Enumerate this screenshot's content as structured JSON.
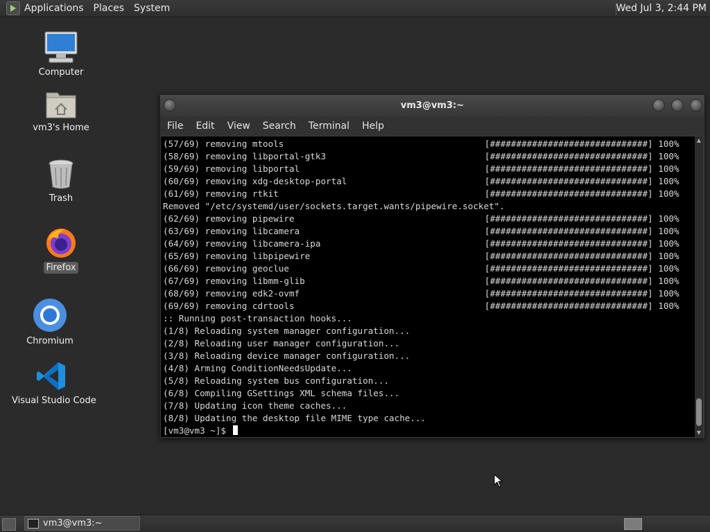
{
  "top_panel": {
    "menus": [
      "Applications",
      "Places",
      "System"
    ],
    "clock": "Wed Jul  3,  2:44 PM"
  },
  "desktop_icons": [
    {
      "label": "Computer",
      "icon": "computer-icon"
    },
    {
      "label": "vm3's Home",
      "icon": "home-folder-icon"
    },
    {
      "label": "Trash",
      "icon": "trash-icon"
    },
    {
      "label": "Firefox",
      "icon": "firefox-icon",
      "selected": true
    },
    {
      "label": "Chromium",
      "icon": "chromium-icon"
    },
    {
      "label": "Visual Studio Code",
      "icon": "vscode-icon"
    }
  ],
  "terminal": {
    "title": "vm3@vm3:~",
    "menu": [
      "File",
      "Edit",
      "View",
      "Search",
      "Terminal",
      "Help"
    ],
    "progress_bar": "[##############################]",
    "progress_pct": "100%",
    "lines": [
      {
        "text": "(57/69) removing mtools",
        "progress": true
      },
      {
        "text": "(58/69) removing libportal-gtk3",
        "progress": true
      },
      {
        "text": "(59/69) removing libportal",
        "progress": true
      },
      {
        "text": "(60/69) removing xdg-desktop-portal",
        "progress": true
      },
      {
        "text": "(61/69) removing rtkit",
        "progress": true
      },
      {
        "text": "Removed \"/etc/systemd/user/sockets.target.wants/pipewire.socket\".",
        "progress": false
      },
      {
        "text": "(62/69) removing pipewire",
        "progress": true
      },
      {
        "text": "(63/69) removing libcamera",
        "progress": true
      },
      {
        "text": "(64/69) removing libcamera-ipa",
        "progress": true
      },
      {
        "text": "(65/69) removing libpipewire",
        "progress": true
      },
      {
        "text": "(66/69) removing geoclue",
        "progress": true
      },
      {
        "text": "(67/69) removing libmm-glib",
        "progress": true
      },
      {
        "text": "(68/69) removing edk2-ovmf",
        "progress": true
      },
      {
        "text": "(69/69) removing cdrtools",
        "progress": true
      },
      {
        "text": ":: Running post-transaction hooks...",
        "progress": false
      },
      {
        "text": "(1/8) Reloading system manager configuration...",
        "progress": false
      },
      {
        "text": "(2/8) Reloading user manager configuration...",
        "progress": false
      },
      {
        "text": "(3/8) Reloading device manager configuration...",
        "progress": false
      },
      {
        "text": "(4/8) Arming ConditionNeedsUpdate...",
        "progress": false
      },
      {
        "text": "(5/8) Reloading system bus configuration...",
        "progress": false
      },
      {
        "text": "(6/8) Compiling GSettings XML schema files...",
        "progress": false
      },
      {
        "text": "(7/8) Updating icon theme caches...",
        "progress": false
      },
      {
        "text": "(8/8) Updating the desktop file MIME type cache...",
        "progress": false
      }
    ],
    "prompt": "[vm3@vm3 ~]$ "
  },
  "bottom_panel": {
    "task_label": "vm3@vm3:~"
  }
}
